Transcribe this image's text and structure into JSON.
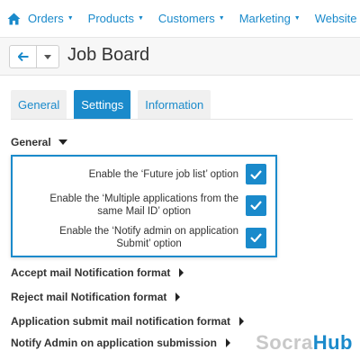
{
  "nav": {
    "home_icon": "home-icon",
    "items": [
      {
        "label": "Orders"
      },
      {
        "label": "Products"
      },
      {
        "label": "Customers"
      },
      {
        "label": "Marketing"
      },
      {
        "label": "Website"
      }
    ]
  },
  "header": {
    "back_icon": "arrow-left-icon",
    "dropdown_icon": "chevron-down-icon",
    "title": "Job Board"
  },
  "tabs": [
    {
      "label": "General",
      "active": false
    },
    {
      "label": "Settings",
      "active": true
    },
    {
      "label": "Information",
      "active": false
    }
  ],
  "general": {
    "title": "General",
    "options": [
      {
        "label": "Enable the ‘Future job list’ option",
        "checked": true
      },
      {
        "label_line1": "Enable the ‘Multiple applications from the",
        "label_line2": "same Mail ID’ option",
        "checked": true
      },
      {
        "label_line1": "Enable the ‘Notify admin on application",
        "label_line2": "Submit’ option",
        "checked": true
      }
    ]
  },
  "sections": [
    {
      "title": "Accept mail Notification format"
    },
    {
      "title": "Reject mail Notification format"
    },
    {
      "title": "Application submit mail notification format"
    },
    {
      "title": "Notify Admin on application submission"
    }
  ],
  "logo": {
    "part1": "Socra",
    "part2": "Hub"
  },
  "colors": {
    "accent": "#1a8acb",
    "logo_gray": "#c8c8c8"
  }
}
